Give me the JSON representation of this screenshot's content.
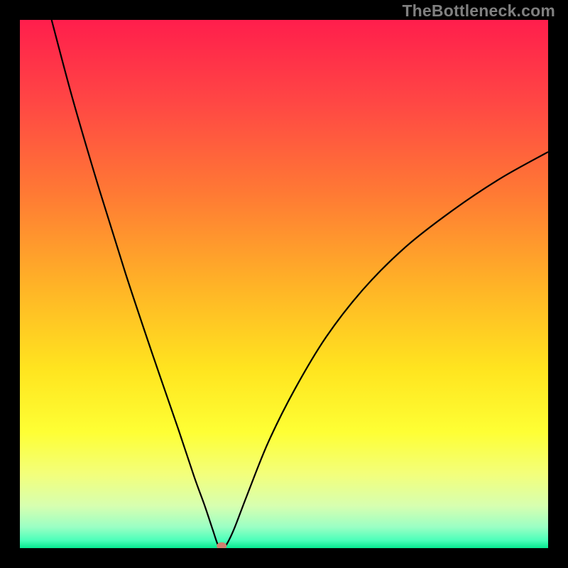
{
  "watermark": "TheBottleneck.com",
  "chart_data": {
    "type": "line",
    "title": "",
    "xlabel": "",
    "ylabel": "",
    "xlim": [
      0,
      100
    ],
    "ylim": [
      0,
      100
    ],
    "grid": false,
    "background_gradient": {
      "stops": [
        {
          "pos": 0.0,
          "color": "#ff1e4c"
        },
        {
          "pos": 0.16,
          "color": "#ff4844"
        },
        {
          "pos": 0.33,
          "color": "#ff7a34"
        },
        {
          "pos": 0.5,
          "color": "#ffb227"
        },
        {
          "pos": 0.66,
          "color": "#ffe41f"
        },
        {
          "pos": 0.78,
          "color": "#feff34"
        },
        {
          "pos": 0.86,
          "color": "#f3ff7b"
        },
        {
          "pos": 0.92,
          "color": "#d7ffb0"
        },
        {
          "pos": 0.96,
          "color": "#9bffc4"
        },
        {
          "pos": 0.985,
          "color": "#4cffba"
        },
        {
          "pos": 1.0,
          "color": "#06e990"
        }
      ]
    },
    "series": [
      {
        "name": "bottleneck-curve",
        "color": "#000000",
        "points": [
          {
            "x": 6.0,
            "y": 100.0
          },
          {
            "x": 10.0,
            "y": 85.0
          },
          {
            "x": 15.0,
            "y": 68.0
          },
          {
            "x": 20.0,
            "y": 52.0
          },
          {
            "x": 25.0,
            "y": 37.0
          },
          {
            "x": 30.0,
            "y": 22.5
          },
          {
            "x": 33.0,
            "y": 13.5
          },
          {
            "x": 35.0,
            "y": 8.0
          },
          {
            "x": 36.5,
            "y": 3.5
          },
          {
            "x": 37.5,
            "y": 0.6
          },
          {
            "x": 38.2,
            "y": 0.0
          },
          {
            "x": 39.0,
            "y": 0.5
          },
          {
            "x": 40.5,
            "y": 3.5
          },
          {
            "x": 43.0,
            "y": 10.0
          },
          {
            "x": 47.0,
            "y": 20.0
          },
          {
            "x": 52.0,
            "y": 30.0
          },
          {
            "x": 58.0,
            "y": 40.0
          },
          {
            "x": 65.0,
            "y": 49.0
          },
          {
            "x": 73.0,
            "y": 57.0
          },
          {
            "x": 82.0,
            "y": 64.0
          },
          {
            "x": 91.0,
            "y": 70.0
          },
          {
            "x": 100.0,
            "y": 75.0
          }
        ]
      }
    ],
    "marker": {
      "x": 38.2,
      "y": 0.4,
      "rx": 0.95,
      "ry": 0.7,
      "color": "#d08070"
    }
  }
}
